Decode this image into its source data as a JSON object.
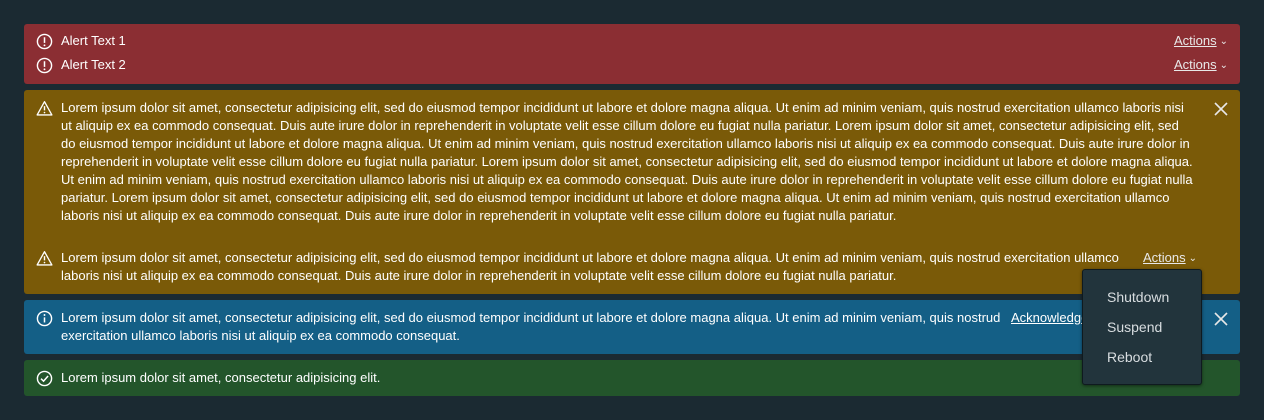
{
  "colors": {
    "page_bg": "#1b2a32",
    "danger": "#8b2e33",
    "warning": "#7a5a08",
    "info": "#145f86",
    "success": "#23552b",
    "dropdown_bg": "#22343c"
  },
  "danger_alert": {
    "icon": "exclamation-circle-icon",
    "items": [
      {
        "text": "Alert Text 1",
        "actions_label": "Actions"
      },
      {
        "text": "Alert Text 2",
        "actions_label": "Actions"
      }
    ]
  },
  "warning_alert": {
    "icon": "exclamation-triangle-icon",
    "items": [
      {
        "text": "Lorem ipsum dolor sit amet, consectetur adipisicing elit, sed do eiusmod tempor incididunt ut labore et dolore magna aliqua. Ut enim ad minim veniam, quis nostrud exercitation ullamco laboris nisi ut aliquip ex ea commodo consequat. Duis aute irure dolor in reprehenderit in voluptate velit esse cillum dolore eu fugiat nulla pariatur. Lorem ipsum dolor sit amet, consectetur adipisicing elit, sed do eiusmod tempor incididunt ut labore et dolore magna aliqua. Ut enim ad minim veniam, quis nostrud exercitation ullamco laboris nisi ut aliquip ex ea commodo consequat. Duis aute irure dolor in reprehenderit in voluptate velit esse cillum dolore eu fugiat nulla pariatur. Lorem ipsum dolor sit amet, consectetur adipisicing elit, sed do eiusmod tempor incididunt ut labore et dolore magna aliqua. Ut enim ad minim veniam, quis nostrud exercitation ullamco laboris nisi ut aliquip ex ea commodo consequat. Duis aute irure dolor in reprehenderit in voluptate velit esse cillum dolore eu fugiat nulla pariatur. Lorem ipsum dolor sit amet, consectetur adipisicing elit, sed do eiusmod tempor incididunt ut labore et dolore magna aliqua. Ut enim ad minim veniam, quis nostrud exercitation ullamco laboris nisi ut aliquip ex ea commodo consequat. Duis aute irure dolor in reprehenderit in voluptate velit esse cillum dolore eu fugiat nulla pariatur."
      },
      {
        "text": "Lorem ipsum dolor sit amet, consectetur adipisicing elit, sed do eiusmod tempor incididunt ut labore et dolore magna aliqua. Ut enim ad minim veniam, quis nostrud exercitation ullamco laboris nisi ut aliquip ex ea commodo consequat. Duis aute irure dolor in reprehenderit in voluptate velit esse cillum dolore eu fugiat nulla pariatur.",
        "actions_label": "Actions"
      }
    ]
  },
  "info_alert": {
    "icon": "info-circle-icon",
    "text": "Lorem ipsum dolor sit amet, consectetur adipisicing elit, sed do eiusmod tempor incididunt ut labore et dolore magna aliqua. Ut enim ad minim veniam, quis nostrud exercitation ullamco laboris nisi ut aliquip ex ea commodo consequat.",
    "action_label": "Acknowledge"
  },
  "success_alert": {
    "icon": "check-circle-icon",
    "text": "Lorem ipsum dolor sit amet, consectetur adipisicing elit."
  },
  "actions_menu": {
    "items": [
      "Shutdown",
      "Suspend",
      "Reboot"
    ]
  }
}
